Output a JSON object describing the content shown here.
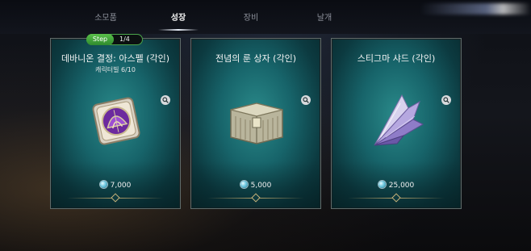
{
  "tabs": [
    {
      "label": "소모품",
      "active": false
    },
    {
      "label": "성장",
      "active": true
    },
    {
      "label": "장비",
      "active": false
    },
    {
      "label": "날개",
      "active": false
    }
  ],
  "step": {
    "label": "Step",
    "count": "1/4"
  },
  "cards": [
    {
      "title": "데바니온 결정: 아스펠 (각인)",
      "subtitle": "캐릭터빌 6/10",
      "price": "7,000",
      "icon": "devanion-crystal-icon"
    },
    {
      "title": "전념의 룬 상자 (각인)",
      "subtitle": "",
      "price": "5,000",
      "icon": "rune-chest-icon"
    },
    {
      "title": "스티그마 샤드 (각인)",
      "subtitle": "",
      "price": "25,000",
      "icon": "stigma-shard-icon"
    }
  ],
  "colors": {
    "card_bg": "#17646a",
    "step_green": "#4ba54a",
    "ornament_gold": "#c7b27a"
  }
}
